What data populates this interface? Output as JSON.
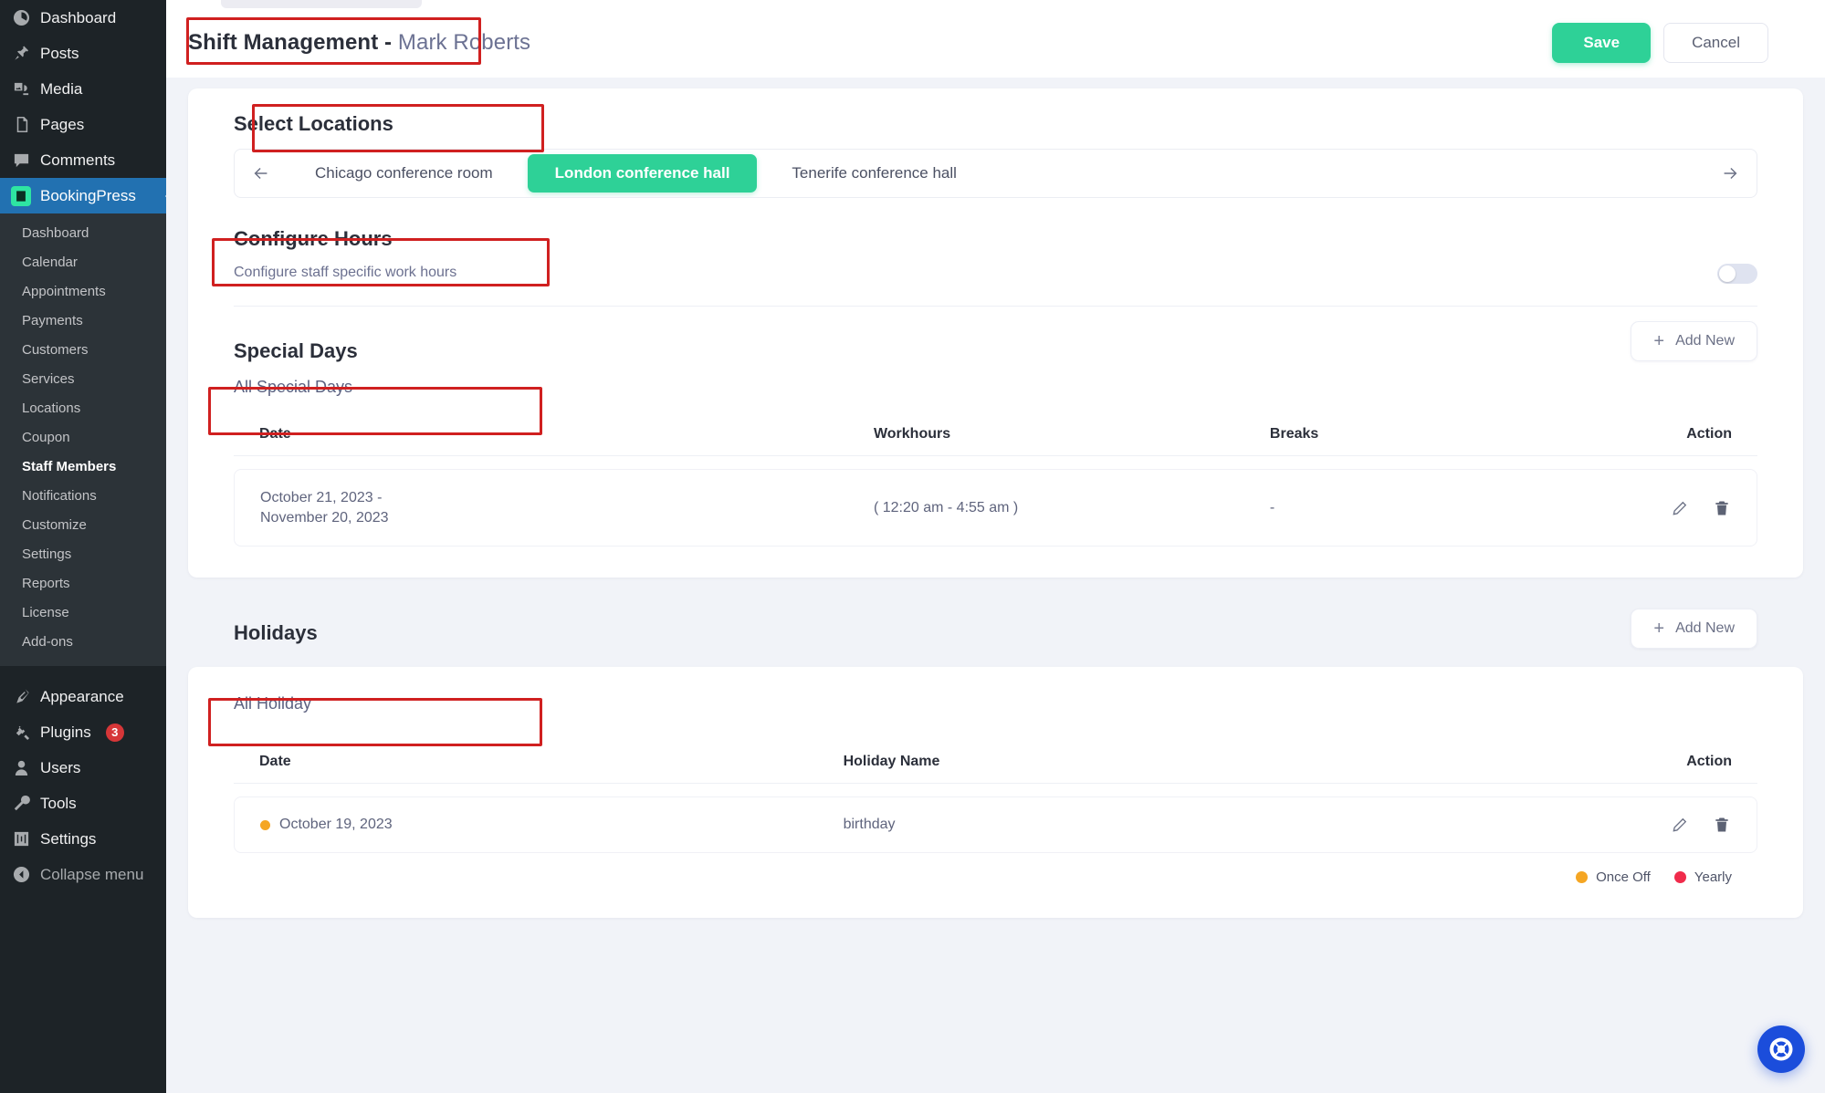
{
  "wp_sidebar": {
    "items": [
      {
        "label": "Dashboard",
        "icon": "dashboard-icon"
      },
      {
        "label": "Posts",
        "icon": "pin-icon"
      },
      {
        "label": "Media",
        "icon": "media-icon"
      },
      {
        "label": "Pages",
        "icon": "pages-icon"
      },
      {
        "label": "Comments",
        "icon": "comment-icon"
      },
      {
        "label": "BookingPress",
        "icon": "bookingpress-icon",
        "active": true
      }
    ],
    "sub_items": [
      {
        "label": "Dashboard"
      },
      {
        "label": "Calendar"
      },
      {
        "label": "Appointments"
      },
      {
        "label": "Payments"
      },
      {
        "label": "Customers"
      },
      {
        "label": "Services"
      },
      {
        "label": "Locations"
      },
      {
        "label": "Coupon"
      },
      {
        "label": "Staff Members",
        "current": true
      },
      {
        "label": "Notifications"
      },
      {
        "label": "Customize"
      },
      {
        "label": "Settings"
      },
      {
        "label": "Reports"
      },
      {
        "label": "License"
      },
      {
        "label": "Add-ons"
      }
    ],
    "bottom_items": [
      {
        "label": "Appearance",
        "icon": "appearance-icon"
      },
      {
        "label": "Plugins",
        "icon": "plugins-icon",
        "badge": "3"
      },
      {
        "label": "Users",
        "icon": "users-icon"
      },
      {
        "label": "Tools",
        "icon": "tools-icon"
      },
      {
        "label": "Settings",
        "icon": "settings-icon"
      },
      {
        "label": "Collapse menu",
        "icon": "collapse-icon"
      }
    ]
  },
  "header": {
    "title_bold": "Shift Management -",
    "title_name": " Mark Roberts",
    "save_label": "Save",
    "cancel_label": "Cancel"
  },
  "locations": {
    "title": "Select Locations",
    "prev_icon": "arrow-left-icon",
    "next_icon": "arrow-right-icon",
    "tabs": [
      {
        "label": "Chicago conference room",
        "selected": false
      },
      {
        "label": "London conference hall",
        "selected": true
      },
      {
        "label": "Tenerife conference hall",
        "selected": false
      }
    ]
  },
  "configure_hours": {
    "title": "Configure Hours",
    "description": "Configure staff specific work hours",
    "toggle_state": "off"
  },
  "special_days": {
    "title": "Special Days",
    "add_new_label": "Add New",
    "subhead": "All Special Days",
    "columns": [
      "Date",
      "Workhours",
      "Breaks",
      "Action"
    ],
    "rows": [
      {
        "date": "October 21, 2023 - November 20, 2023",
        "workhours": "( 12:20 am - 4:55 am )",
        "breaks": "-",
        "edit_icon": "pencil-icon",
        "delete_icon": "trash-icon"
      }
    ]
  },
  "holidays": {
    "title": "Holidays",
    "add_new_label": "Add New",
    "subhead": "All Holiday",
    "columns": [
      "Date",
      "Holiday Name",
      "Action"
    ],
    "rows": [
      {
        "date": "October 19, 2023",
        "name": "birthday",
        "dot_color": "#f5a623",
        "edit_icon": "pencil-icon",
        "delete_icon": "trash-icon"
      }
    ],
    "legend": [
      {
        "label": "Once Off",
        "color": "#f5a623"
      },
      {
        "label": "Yearly",
        "color": "#f02b4b"
      }
    ]
  },
  "help": {
    "icon": "lifebuoy-icon"
  },
  "colors": {
    "accent_green": "#2ed197",
    "wp_blue": "#2271b1",
    "help_blue": "#1b4ddb",
    "annotation_red": "#d02020"
  }
}
